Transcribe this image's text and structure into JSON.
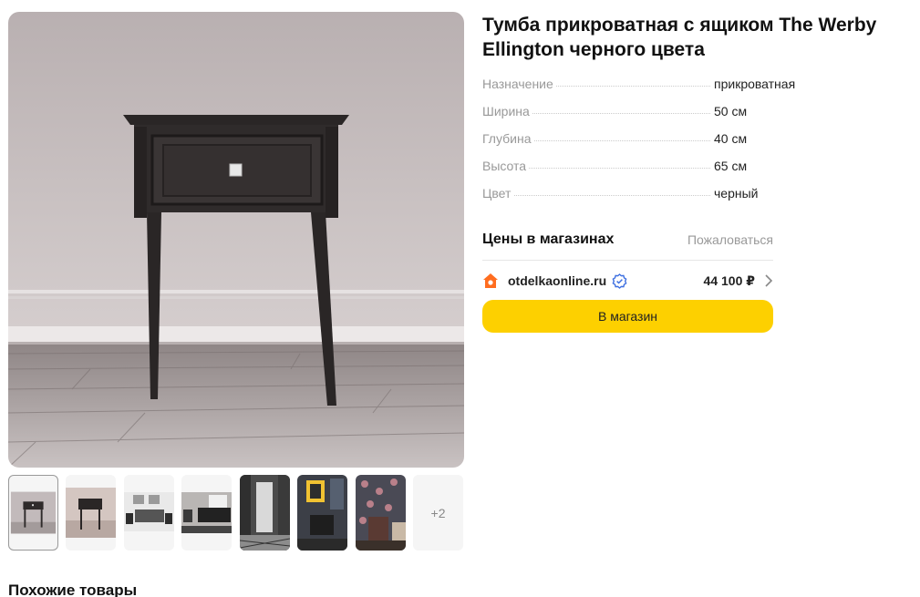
{
  "product": {
    "title_line1": "Тумба прикроватная с ящиком The Werby",
    "title_line2": "Ellington черного цвета"
  },
  "gallery": {
    "thumbnails": [
      {
        "name": "thumb-nightstand-front"
      },
      {
        "name": "thumb-nightstand-angle"
      },
      {
        "name": "thumb-bedroom-white"
      },
      {
        "name": "thumb-bedroom-dark"
      },
      {
        "name": "thumb-hallway"
      },
      {
        "name": "thumb-interior-yellow-art"
      },
      {
        "name": "thumb-interior-floral"
      }
    ],
    "more_label": "+2"
  },
  "specs": [
    {
      "name": "Назначение",
      "value": "прикроватная"
    },
    {
      "name": "Ширина",
      "value": "50 см"
    },
    {
      "name": "Глубина",
      "value": "40 см"
    },
    {
      "name": "Высота",
      "value": "65 см"
    },
    {
      "name": "Цвет",
      "value": "черный"
    }
  ],
  "prices": {
    "title": "Цены в магазинах",
    "complain_label": "Пожаловаться",
    "offers": [
      {
        "shop": "otdelkaonline.ru",
        "price": "44 100 ₽",
        "verified": true
      }
    ],
    "button_label": "В магазин"
  },
  "similar": {
    "title": "Похожие товары"
  },
  "colors": {
    "accent_button": "#fdd000",
    "shop_icon": "#ff6d1f",
    "verified": "#3d6fe0",
    "muted_text": "#999999"
  },
  "icons": [
    "shop-house-icon",
    "verified-badge-icon",
    "chevron-right-icon"
  ]
}
